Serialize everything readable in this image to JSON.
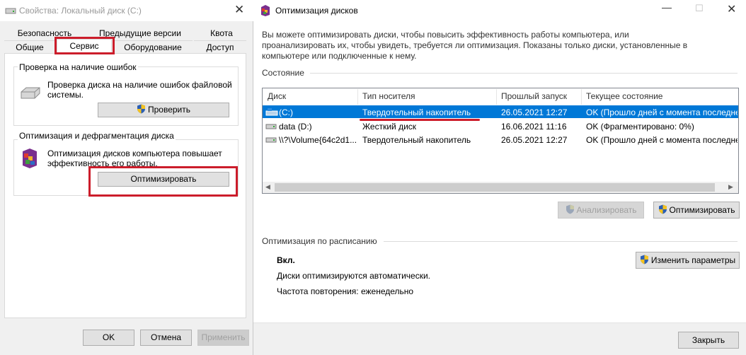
{
  "left_window": {
    "title": "Свойства: Локальный диск (C:)",
    "close_glyph": "✕",
    "tabs_row1": [
      "Безопасность",
      "Предыдущие версии",
      "Квота"
    ],
    "tabs_row2": [
      "Общие",
      "Сервис",
      "Оборудование",
      "Доступ"
    ],
    "error_check": {
      "title": "Проверка на наличие ошибок",
      "description": "Проверка диска на наличие ошибок файловой системы.",
      "button": "Проверить"
    },
    "optimize": {
      "title": "Оптимизация и дефрагментация диска",
      "description": "Оптимизация дисков компьютера повышает эффективность его работы.",
      "button": "Оптимизировать"
    },
    "footer": {
      "ok": "OK",
      "cancel": "Отмена",
      "apply": "Применить"
    },
    "highlight_color": "#cc1d2b"
  },
  "right_window": {
    "title": "Оптимизация дисков",
    "minimize_glyph": "—",
    "maximize_glyph": "☐",
    "close_glyph": "✕",
    "intro": "Вы можете оптимизировать диски, чтобы повысить эффективность работы  компьютера, или проанализировать их, чтобы увидеть, требуется ли оптимизация. Показаны только диски, установленные в компьютере или подключенные к нему.",
    "state_label": "Состояние",
    "columns": [
      "Диск",
      "Тип носителя",
      "Прошлый запуск",
      "Текущее состояние"
    ],
    "rows": [
      {
        "disk": "(C:)",
        "media": "Твердотельный накопитель",
        "last_run": "26.05.2021 12:27",
        "status": "OK (Прошло дней с момента последне",
        "selected": true
      },
      {
        "disk": "data (D:)",
        "media": "Жесткий диск",
        "last_run": "16.06.2021 11:16",
        "status": "OK (Фрагментировано: 0%)",
        "selected": false
      },
      {
        "disk": "\\\\?\\Volume{64c2d1...",
        "media": "Твердотельный накопитель",
        "last_run": "26.05.2021 12:27",
        "status": "OK (Прошло дней с момента последне",
        "selected": false
      }
    ],
    "analyze_button": "Анализировать",
    "optimize_button": "Оптимизировать",
    "schedule": {
      "title": "Оптимизация по расписанию",
      "state": "Вкл.",
      "line1": "Диски оптимизируются автоматически.",
      "line2": "Частота повторения: еженедельно",
      "change_button": "Изменить параметры"
    },
    "close_button": "Закрыть",
    "selection_color": "#0078d7"
  }
}
